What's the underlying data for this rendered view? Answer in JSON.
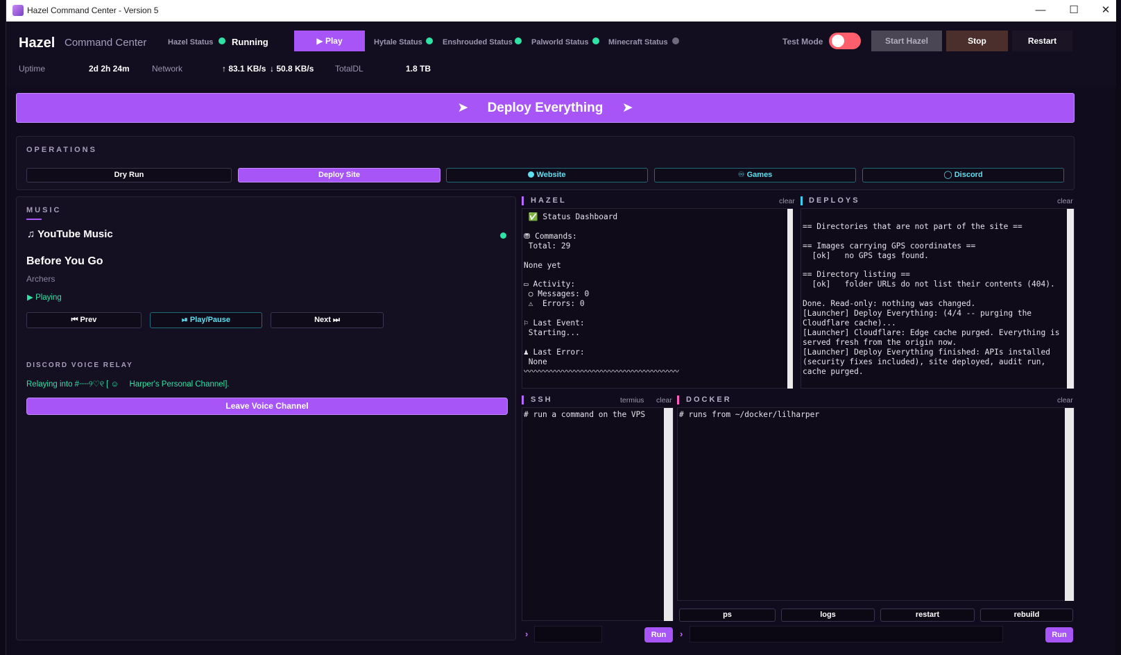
{
  "window": {
    "title": "Hazel Command Center - Version 5"
  },
  "header": {
    "app_name": "Hazel",
    "app_subtitle": "Command Center",
    "hazel_status_label": "Hazel Status",
    "hazel_status_value": "Running",
    "play_label": "▶ Play",
    "hytale_label": "Hytale Status",
    "enshrouded_label": "Enshrouded Status",
    "palworld_label": "Palworld Status",
    "minecraft_label": "Minecraft Status",
    "test_mode_label": "Test Mode",
    "start_label": "Start Hazel",
    "stop_label": "Stop",
    "restart_label": "Restart",
    "uptime_label": "Uptime",
    "uptime_value": "2d 2h 24m",
    "network_label": "Network",
    "network_up": "↑ 83.1 KB/s",
    "network_down": "↓ 50.8 KB/s",
    "totaldl_label": "TotalDL",
    "totaldl_value": "1.8 TB",
    "colors": {
      "accent": "#a855f7",
      "online": "#2fe3a5",
      "offline": "#6f6a7e",
      "toggle": "#ff5f6d"
    }
  },
  "deploy_banner": {
    "label": "Deploy Everything",
    "icon": "rocket-icon"
  },
  "operations": {
    "title": "OPERATIONS",
    "buttons": [
      "Dry Run",
      "Deploy Site",
      "Website",
      "Games",
      "Discord"
    ]
  },
  "music": {
    "title": "MUSIC",
    "service": "YouTube Music",
    "track": "Before You Go",
    "artist": "Archers",
    "state": "Playing",
    "prev": "Prev",
    "playpause": "Play/Pause",
    "next": "Next",
    "relay_title": "DISCORD VOICE RELAY",
    "relay_prefix": "Relaying into #┈┈୨♡୧ [",
    "relay_channel": "Harper's Personal Channel].",
    "leave": "Leave Voice Channel"
  },
  "hazel_term": {
    "title": "HAZEL",
    "clear": "clear",
    "lines": [
      " ✅ Status Dashboard",
      "",
      "⛃ Commands:",
      " Total: 29",
      "",
      "None yet",
      "",
      "▭ Activity:",
      " ○ Messages: 0",
      " ⚠  Errors: 0",
      "",
      "⚐ Last Event:",
      " Starting...",
      "",
      "♟ Last Error:",
      " None",
      "〰〰〰〰〰〰〰〰〰〰〰〰〰〰〰〰〰〰〰〰"
    ]
  },
  "deploys_term": {
    "title": "DEPLOYS",
    "clear": "clear",
    "lines": [
      "",
      "== Directories that are not part of the site ==",
      "",
      "== Images carrying GPS coordinates ==",
      "  [ok]   no GPS tags found.",
      "",
      "== Directory listing ==",
      "  [ok]   folder URLs do not list their contents (404).",
      "",
      "Done. Read-only: nothing was changed.",
      "[Launcher] Deploy Everything: (4/4 -- purging the",
      "Cloudflare cache)...",
      "[Launcher] Cloudflare: Edge cache purged. Everything is",
      "served fresh from the origin now.",
      "[Launcher] Deploy Everything finished: APIs installed",
      "(security fixes included), site deployed, audit run,",
      "cache purged."
    ]
  },
  "ssh_term": {
    "title": "SSH",
    "termius": "termius",
    "clear": "clear",
    "placeholder_line": "# run a command on the VPS",
    "run": "Run"
  },
  "docker_term": {
    "title": "DOCKER",
    "clear": "clear",
    "placeholder_line": "# runs from ~/docker/lilharper",
    "buttons": [
      "ps",
      "logs",
      "restart",
      "rebuild"
    ],
    "run": "Run"
  }
}
